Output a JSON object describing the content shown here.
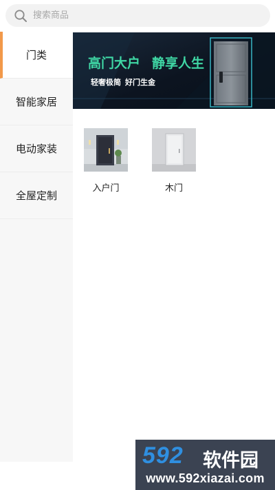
{
  "search": {
    "placeholder": "搜索商品",
    "icon": "search-icon"
  },
  "sidebar": {
    "accent_color": "#f2994a",
    "items": [
      {
        "label": "门类",
        "active": true
      },
      {
        "label": "智能家居",
        "active": false
      },
      {
        "label": "电动家装",
        "active": false
      },
      {
        "label": "全屋定制",
        "active": false
      }
    ]
  },
  "banner": {
    "headline_left": "高门大户",
    "headline_right": "静享人生",
    "sub_left": "轻奢极简",
    "sub_right": "好门生金",
    "headline_color": "#3fd6a4",
    "background_color": "#0d1724"
  },
  "products": [
    {
      "label": "入户门",
      "image": "dark-entry-door"
    },
    {
      "label": "木门",
      "image": "white-wood-door"
    }
  ],
  "watermark": {
    "number": "592",
    "brand": "软件园",
    "url": "www.592xiazai.com",
    "number_color": "#2f8fe0"
  }
}
